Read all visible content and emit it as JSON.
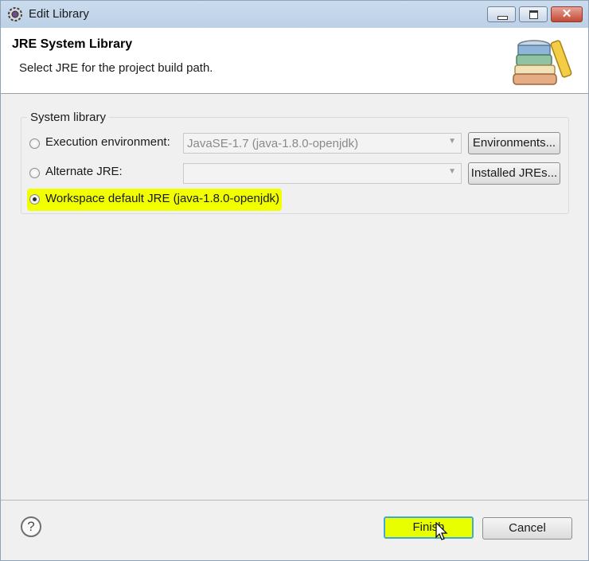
{
  "window": {
    "title": "Edit Library",
    "controls": {
      "minimize": "minimize",
      "maximize": "maximize",
      "close": "✕"
    }
  },
  "banner": {
    "title": "JRE System Library",
    "description": "Select JRE for the project build path.",
    "image_icon": "books-icon"
  },
  "group": {
    "label": "System library",
    "options": [
      {
        "label": "Execution environment:",
        "selected": false,
        "combo_value": "JavaSE-1.7 (java-1.8.0-openjdk)",
        "button": "Environments..."
      },
      {
        "label": "Alternate JRE:",
        "selected": false,
        "combo_value": "",
        "button": "Installed JREs..."
      },
      {
        "label": "Workspace default JRE (java-1.8.0-openjdk)",
        "selected": true
      }
    ]
  },
  "footer": {
    "help": "?",
    "finish": "Finish",
    "cancel": "Cancel"
  },
  "colors": {
    "highlight": "#f1ff00",
    "titlebar": "#c2d5ea",
    "focus_border": "#40a9d8"
  }
}
